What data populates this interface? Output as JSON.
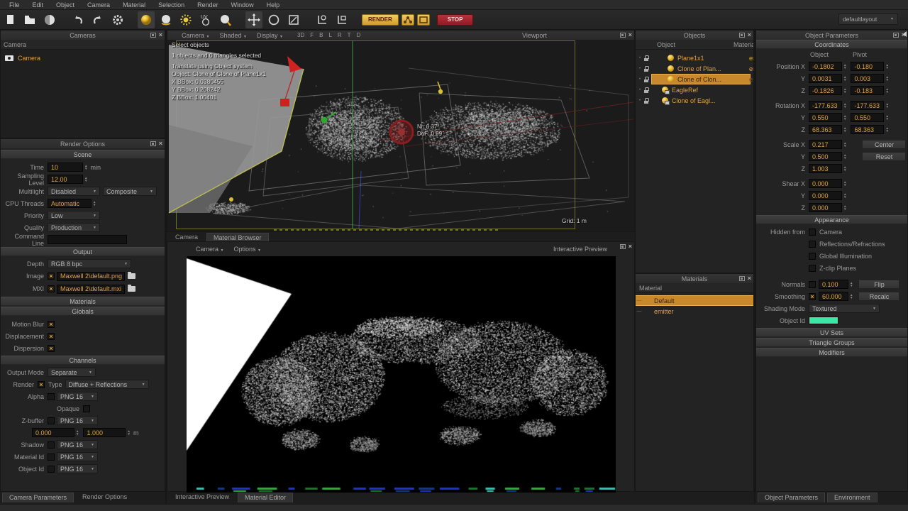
{
  "menu": {
    "items": [
      "File",
      "Edit",
      "Object",
      "Camera",
      "Material",
      "Selection",
      "Render",
      "Window",
      "Help"
    ]
  },
  "toolbar": {
    "render_label": "RENDER",
    "stop_label": "STOP",
    "layout_value": "defaultlayout",
    "icons": [
      "new-scene-icon",
      "open-scene-icon",
      "render-sphere-icon",
      "undo-icon",
      "redo-icon",
      "preferences-gear-icon",
      "emitter-sphere-icon",
      "material-sphere-icon",
      "sun-icon",
      "uv-editor-icon",
      "preview-sphere-icon",
      "move-tool-icon",
      "rotate-tool-icon",
      "scale-tool-icon",
      "pivot-axis-icon",
      "axis-plane-icon",
      "network-render-icon",
      "region-render-icon"
    ]
  },
  "cameras_panel": {
    "title": "Cameras",
    "column_header": "Camera",
    "items": [
      {
        "label": "Camera"
      }
    ]
  },
  "render_options": {
    "title": "Render Options",
    "scene": {
      "header": "Scene",
      "time_label": "Time",
      "time_value": "10",
      "time_unit": "min",
      "sampling_label": "Sampling Level",
      "sampling_value": "12.00",
      "multilight_label": "Multilight",
      "multilight_value": "Disabled",
      "multilight_mode": "Composite",
      "cpu_label": "CPU Threads",
      "cpu_value": "Automatic",
      "priority_label": "Priority",
      "priority_value": "Low",
      "quality_label": "Quality",
      "quality_value": "Production",
      "command_label": "Command Line",
      "command_value": ""
    },
    "output": {
      "header": "Output",
      "depth_label": "Depth",
      "depth_value": "RGB  8 bpc",
      "image_label": "Image",
      "image_value": "Maxwell 2\\default.png",
      "mxi_label": "MXI",
      "mxi_value": "Maxwell 2\\default.mxi"
    },
    "materials_header": "Materials",
    "globals": {
      "header": "Globals",
      "motion_blur_label": "Motion Blur",
      "displacement_label": "Displacement",
      "dispersion_label": "Dispersion"
    },
    "channels": {
      "header": "Channels",
      "output_mode_label": "Output Mode",
      "output_mode_value": "Separate",
      "render_label": "Render",
      "type_label": "Type",
      "type_value": "Diffuse + Reflections",
      "alpha_label": "Alpha",
      "alpha_format": "PNG 16",
      "opaque_label": "Opaque",
      "zbuffer_label": "Z-buffer",
      "zbuffer_format": "PNG 16",
      "z_near": "0.000",
      "z_far": "1.000",
      "z_unit": "m",
      "shadow_label": "Shadow",
      "shadow_format": "PNG 16",
      "material_id_label": "Material Id",
      "material_id_format": "PNG 16",
      "object_id_label": "Object Id",
      "object_id_format": "PNG 16"
    },
    "bottom_tabs": [
      "Camera Parameters",
      "Render Options"
    ]
  },
  "viewport": {
    "title": "Viewport",
    "camera_dropdown": "Camera",
    "shade_dropdown": "Shaded",
    "display_dropdown": "Display",
    "view_buttons": [
      "3D",
      "F",
      "B",
      "L",
      "R",
      "T",
      "D"
    ],
    "overlay": {
      "mode": "Select objects",
      "selection": "1 objects and 0 triangles selected",
      "translate": "Translate using Object system",
      "object": "Object: Clone of Clone of Plane1x1",
      "xbbox": "X BBox: 0.0380455",
      "ybbox": "Y BBox: 0.208242",
      "zbbox": "Z BBox: 1.00401"
    },
    "tooltip": [
      "Nr: 0.37",
      "DoF: 0.99"
    ],
    "grid_label": "Grid: 1 m",
    "tabs": [
      "Camera",
      "Material Browser"
    ]
  },
  "preview": {
    "title": "Interactive Preview",
    "camera_dropdown": "Camera",
    "options_dropdown": "Options",
    "tabs": [
      "Interactive Preview",
      "Material Editor"
    ]
  },
  "objects_panel": {
    "title": "Objects",
    "columns": [
      "Object",
      "Material"
    ],
    "rows": [
      {
        "name": "Plane1x1",
        "material": "emitter",
        "selected": false
      },
      {
        "name": "Clone of Plan...",
        "material": "emitter",
        "selected": false
      },
      {
        "name": "Clone of Clon...",
        "material": "emitter",
        "selected": true
      },
      {
        "name": "EagleRef",
        "material": "",
        "selected": false
      },
      {
        "name": "Clone of Eagl...",
        "material": "",
        "selected": false
      }
    ]
  },
  "materials_panel": {
    "title": "Materials",
    "column_header": "Material",
    "rows": [
      {
        "name": "Default",
        "selected": true
      },
      {
        "name": "emitter",
        "selected": false
      }
    ]
  },
  "object_params": {
    "title": "Object Parameters",
    "coordinates_header": "Coordinates",
    "col_object": "Object",
    "col_pivot": "Pivot",
    "coord_rows": [
      {
        "label": "Position X",
        "object": "-0.1802",
        "pivot": "-0.180"
      },
      {
        "label": "Y",
        "object": "0.0031",
        "pivot": "0.003"
      },
      {
        "label": "Z",
        "object": "-0.1826",
        "pivot": "-0.183"
      },
      {
        "label": "Rotation X",
        "object": "-177.633",
        "pivot": "-177.633"
      },
      {
        "label": "Y",
        "object": "0.550",
        "pivot": "0.550"
      },
      {
        "label": "Z",
        "object": "68.363",
        "pivot": "68.363"
      }
    ],
    "scale_rows": [
      {
        "label": "Scale X",
        "value": "0.217"
      },
      {
        "label": "Y",
        "value": "0.500"
      },
      {
        "label": "Z",
        "value": "1.003"
      }
    ],
    "center_button": "Center",
    "reset_button": "Reset",
    "shear_rows": [
      {
        "label": "Shear X",
        "value": "0.000"
      },
      {
        "label": "Y",
        "value": "0.000"
      },
      {
        "label": "Z",
        "value": "0.000"
      }
    ],
    "appearance_header": "Appearance",
    "hidden_from_label": "Hidden from",
    "hidden_options": [
      "Camera",
      "Reflections/Refractions",
      "Global Illumination",
      "Z-clip Planes"
    ],
    "normals_label": "Normals",
    "normals_value": "0.100",
    "flip_button": "Flip",
    "smoothing_label": "Smoothing",
    "smoothing_value": "60.000",
    "recalc_button": "Recalc",
    "shading_label": "Shading Mode",
    "shading_value": "Textured",
    "object_id_label": "Object Id",
    "object_id_color": "#3ce6a4",
    "uv_sets_header": "UV Sets",
    "triangle_groups_header": "Triangle Groups",
    "modifiers_header": "Modifiers",
    "bottom_tabs": [
      "Object Parameters",
      "Environment"
    ]
  },
  "colors": {
    "accent": "#e0a23c",
    "selection": "#c9882a",
    "object_id_swatch": "#3ce6a4"
  }
}
